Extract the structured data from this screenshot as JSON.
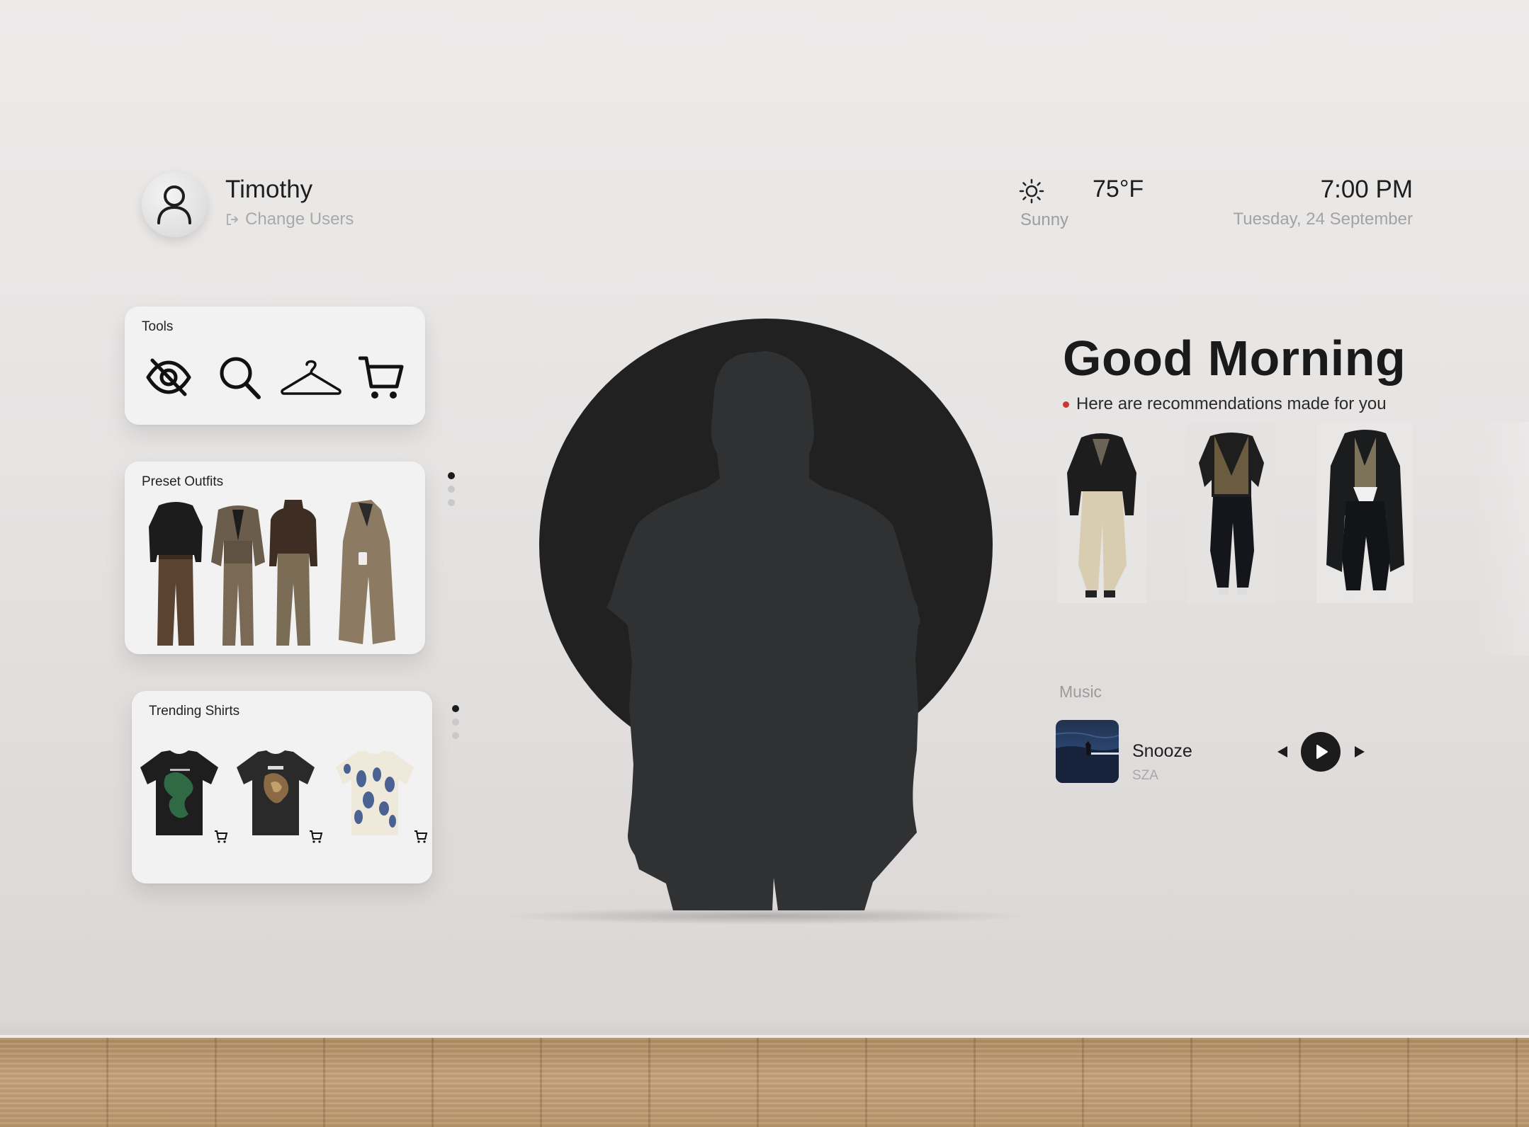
{
  "user": {
    "name": "Timothy",
    "change_label": "Change Users"
  },
  "weather": {
    "temperature": "75°F",
    "condition": "Sunny",
    "icon": "sun-icon"
  },
  "clock": {
    "time": "7:00 PM",
    "date": "Tuesday, 24 September"
  },
  "tools": {
    "title": "Tools",
    "items": [
      {
        "icon": "eye-off-icon"
      },
      {
        "icon": "search-icon"
      },
      {
        "icon": "hanger-icon"
      },
      {
        "icon": "cart-icon"
      }
    ]
  },
  "preset_outfits": {
    "title": "Preset Outfits",
    "count": 4,
    "page_dots": 3,
    "active_dot": 0
  },
  "trending_shirts": {
    "title": "Trending Shirts",
    "count": 3,
    "page_dots": 3,
    "active_dot": 0
  },
  "greeting": {
    "title": "Good Morning",
    "subtitle": "Here are recommendations made for you"
  },
  "recommendations": {
    "count": 3
  },
  "music": {
    "label": "Music",
    "song": "Snooze",
    "artist": "SZA"
  },
  "colors": {
    "background": "#e6e4e3",
    "dark": "#212121",
    "accent_dot": "#c7392f",
    "silhouette": "#2f3133"
  }
}
